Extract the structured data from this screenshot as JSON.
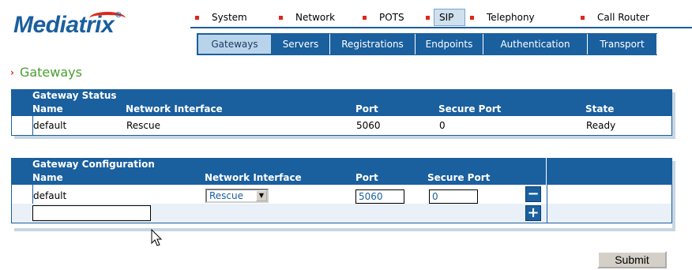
{
  "logo": {
    "text": "Mediatrix",
    "mark": "®"
  },
  "top_menu": [
    {
      "label": "System",
      "selected": false
    },
    {
      "label": "Network",
      "selected": false
    },
    {
      "label": "POTS",
      "selected": false
    },
    {
      "label": "SIP",
      "selected": true
    },
    {
      "label": "Telephony",
      "selected": false
    },
    {
      "label": "Call Router",
      "selected": false
    }
  ],
  "sub_menu": [
    "Gateways",
    "Servers",
    "Registrations",
    "Endpoints",
    "Authentication",
    "Transport"
  ],
  "sub_menu_selected": "Gateways",
  "page_title": "Gateways",
  "status": {
    "caption": "Gateway Status",
    "headers": {
      "name": "Name",
      "interface": "Network Interface",
      "port": "Port",
      "secure_port": "Secure Port",
      "state": "State"
    },
    "rows": [
      {
        "name": "default",
        "interface": "Rescue",
        "port": "5060",
        "secure_port": "0",
        "state": "Ready"
      }
    ]
  },
  "config": {
    "caption": "Gateway Configuration",
    "headers": {
      "name": "Name",
      "interface": "Network Interface",
      "port": "Port",
      "secure_port": "Secure Port"
    },
    "rows": [
      {
        "name": "default",
        "interface": "Rescue",
        "port": "5060",
        "secure_port": "0"
      }
    ],
    "new_name_value": "",
    "remove_label": "−",
    "add_label": "+"
  },
  "submit_label": "Submit",
  "colors": {
    "brand_blue": "#1a5f9e",
    "accent_red": "#e1261c",
    "title_green": "#4a9e2f"
  }
}
